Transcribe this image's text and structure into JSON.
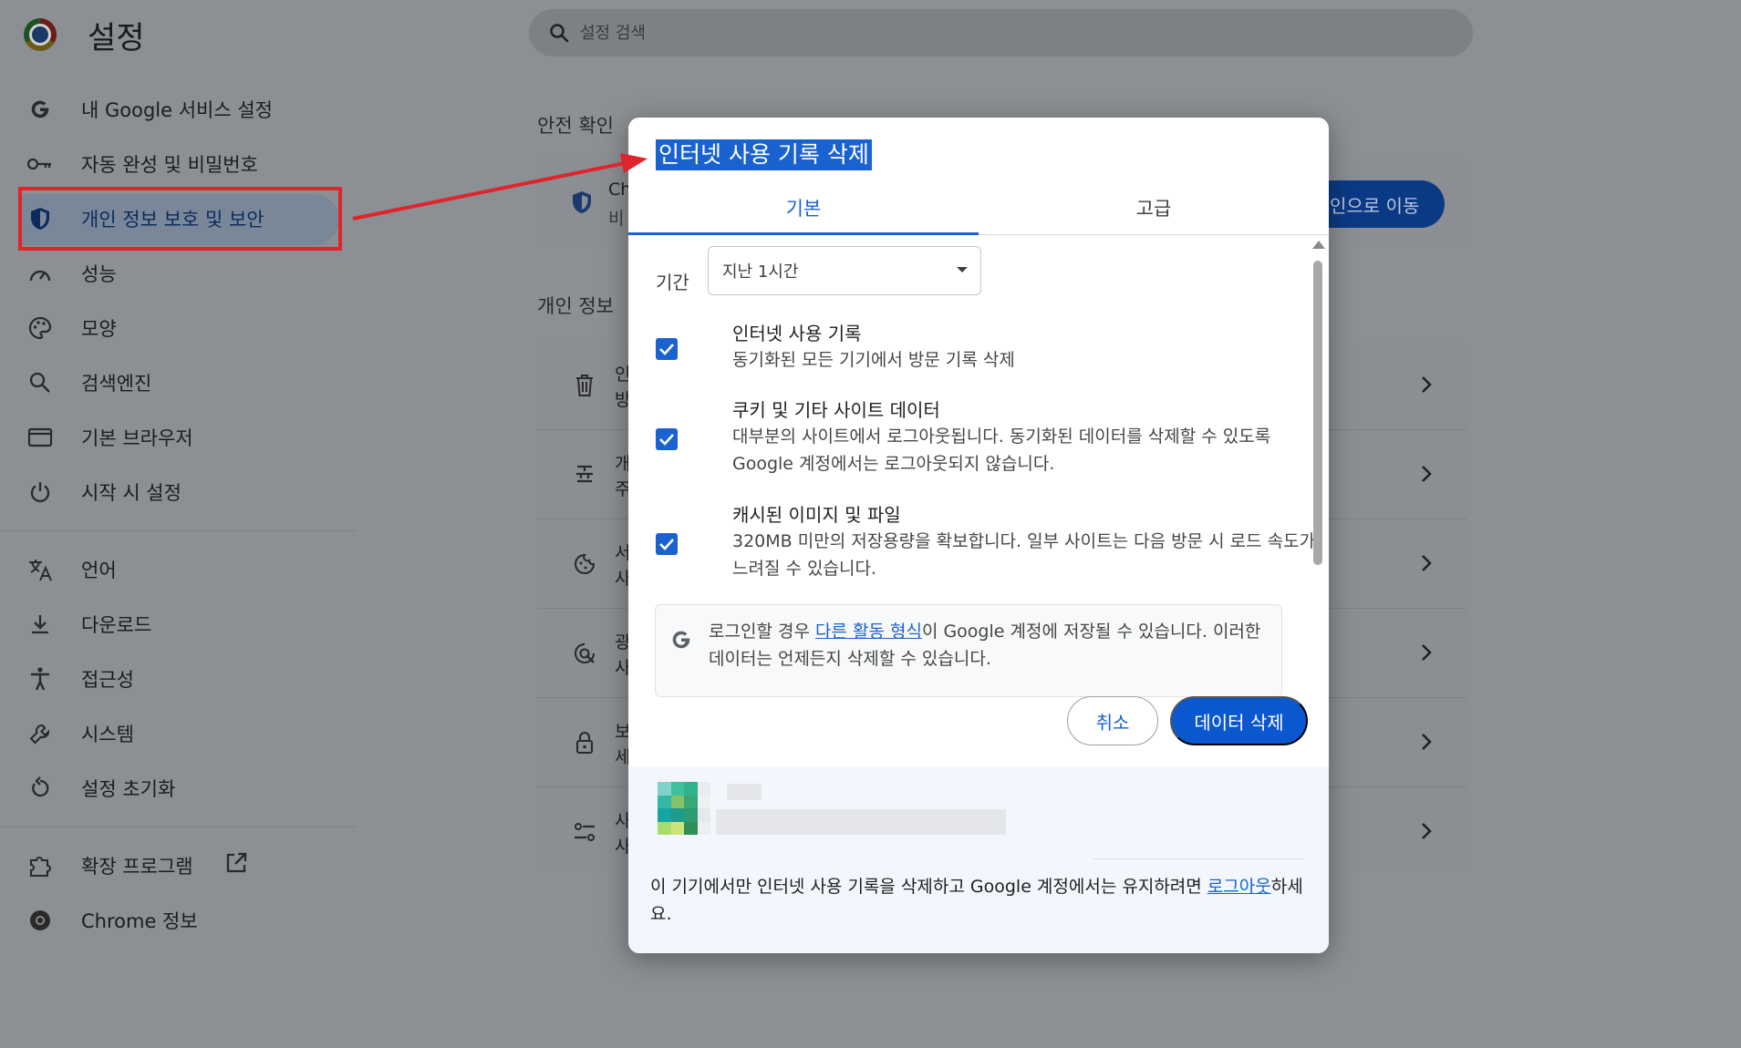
{
  "app": {
    "title": "설정"
  },
  "search": {
    "placeholder": "설정 검색"
  },
  "sidebar": {
    "items": [
      {
        "label": "내 Google 서비스 설정",
        "icon": "google-g-icon"
      },
      {
        "label": "자동 완성 및 비밀번호",
        "icon": "key-icon"
      },
      {
        "label": "개인 정보 보호 및 보안",
        "icon": "shield-icon",
        "active": true
      },
      {
        "label": "성능",
        "icon": "speedometer-icon"
      },
      {
        "label": "모양",
        "icon": "palette-icon"
      },
      {
        "label": "검색엔진",
        "icon": "search-icon"
      },
      {
        "label": "기본 브라우저",
        "icon": "browser-window-icon"
      },
      {
        "label": "시작 시 설정",
        "icon": "power-icon"
      }
    ],
    "items2": [
      {
        "label": "언어",
        "icon": "translate-icon"
      },
      {
        "label": "다운로드",
        "icon": "download-icon"
      },
      {
        "label": "접근성",
        "icon": "accessibility-icon"
      },
      {
        "label": "시스템",
        "icon": "wrench-icon"
      },
      {
        "label": "설정 초기화",
        "icon": "reset-icon"
      }
    ],
    "items3": [
      {
        "label": "확장 프로그램",
        "icon": "puzzle-icon"
      },
      {
        "label": "Chrome 정보",
        "icon": "chrome-icon"
      }
    ]
  },
  "main": {
    "safety_title": "안전 확인",
    "safety_card_line1": "Ch",
    "safety_card_line2": "비",
    "go_button": "인으로 이동",
    "privacy_title": "개인 정보",
    "rows": [
      {
        "l1": "인",
        "l2": "방"
      },
      {
        "l1": "개",
        "l2": "주"
      },
      {
        "l1": "서",
        "l2": "사"
      },
      {
        "l1": "광",
        "l2": "사"
      },
      {
        "l1": "보",
        "l2": "세"
      },
      {
        "l1": "사",
        "l2": "사"
      }
    ]
  },
  "dialog": {
    "title": "인터넷 사용 기록 삭제",
    "tabs": [
      "기본",
      "고급"
    ],
    "period_label": "기간",
    "period_value": "지난 1시간",
    "options": [
      {
        "title": "인터넷 사용 기록",
        "desc": "동기화된 모든 기기에서 방문 기록 삭제",
        "checked": true
      },
      {
        "title": "쿠키 및 기타 사이트 데이터",
        "desc": "대부분의 사이트에서 로그아웃됩니다. 동기화된 데이터를 삭제할 수 있도록 Google 계정에서는 로그아웃되지 않습니다.",
        "checked": true
      },
      {
        "title": "캐시된 이미지 및 파일",
        "desc": "320MB 미만의 저장용량을 확보합니다. 일부 사이트는 다음 방문 시 로드 속도가 느려질 수 있습니다.",
        "checked": true
      }
    ],
    "info": {
      "before": "로그인할 경우 ",
      "link": "다른 활동 형식",
      "after": "이 Google 계정에 저장될 수 있습니다. 이러한 데이터는 언제든지 삭제할 수 있습니다."
    },
    "cancel_label": "취소",
    "confirm_label": "데이터 삭제",
    "bottom": {
      "before": "이 기기에서만 인터넷 사용 기록을 삭제하고 Google 계정에서는 유지하려면 ",
      "link": "로그아웃",
      "after": "하세요."
    }
  },
  "colors": {
    "accent": "#0b57d0",
    "annotation_red": "#e0242b",
    "title_highlight": "#1a62d0"
  }
}
